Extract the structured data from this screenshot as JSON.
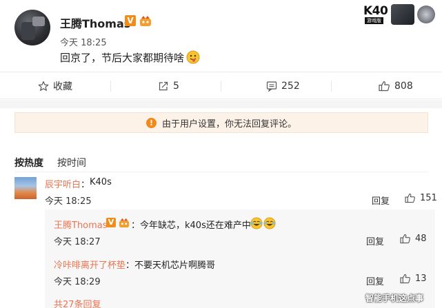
{
  "post": {
    "username": "王腾Thomas",
    "verified_badge": "V",
    "time": "今天 18:25",
    "text": "回京了，节后大家都期待啥"
  },
  "promo": {
    "title": "K40",
    "subtitle": "游戏版"
  },
  "actions": {
    "favorite_label": "收藏",
    "share_count": "5",
    "comment_count": "252",
    "like_count": "808"
  },
  "notice": {
    "text": "由于用户设置，你无法回复评论。"
  },
  "sort": {
    "hot": "按热度",
    "time": "按时间"
  },
  "comments": [
    {
      "user": "辰宇听白",
      "sep": "：",
      "text": "K40s",
      "time": "今天 18:25",
      "reply_label": "回复",
      "likes": "151",
      "replies": [
        {
          "user": "王腾Thomas",
          "badge": "V",
          "sep": "：",
          "text": "今年缺芯，k40s还在难产中",
          "time": "今天 18:27",
          "reply_label": "回复",
          "likes": "48"
        },
        {
          "user": "冷咔啡离开了杯垫",
          "sep": "：",
          "text": "不要天机芯片啊腾哥",
          "time": "今天 18:29",
          "reply_label": "回复",
          "likes": "13"
        }
      ],
      "more_replies": "共27条回复"
    }
  ],
  "watermark": "智能手机这点事",
  "colors": {
    "username_link": "#eb7350",
    "verified": "#f08c1c",
    "notice_bg": "#fdf2e8",
    "notice_icon": "#f28a1b"
  }
}
